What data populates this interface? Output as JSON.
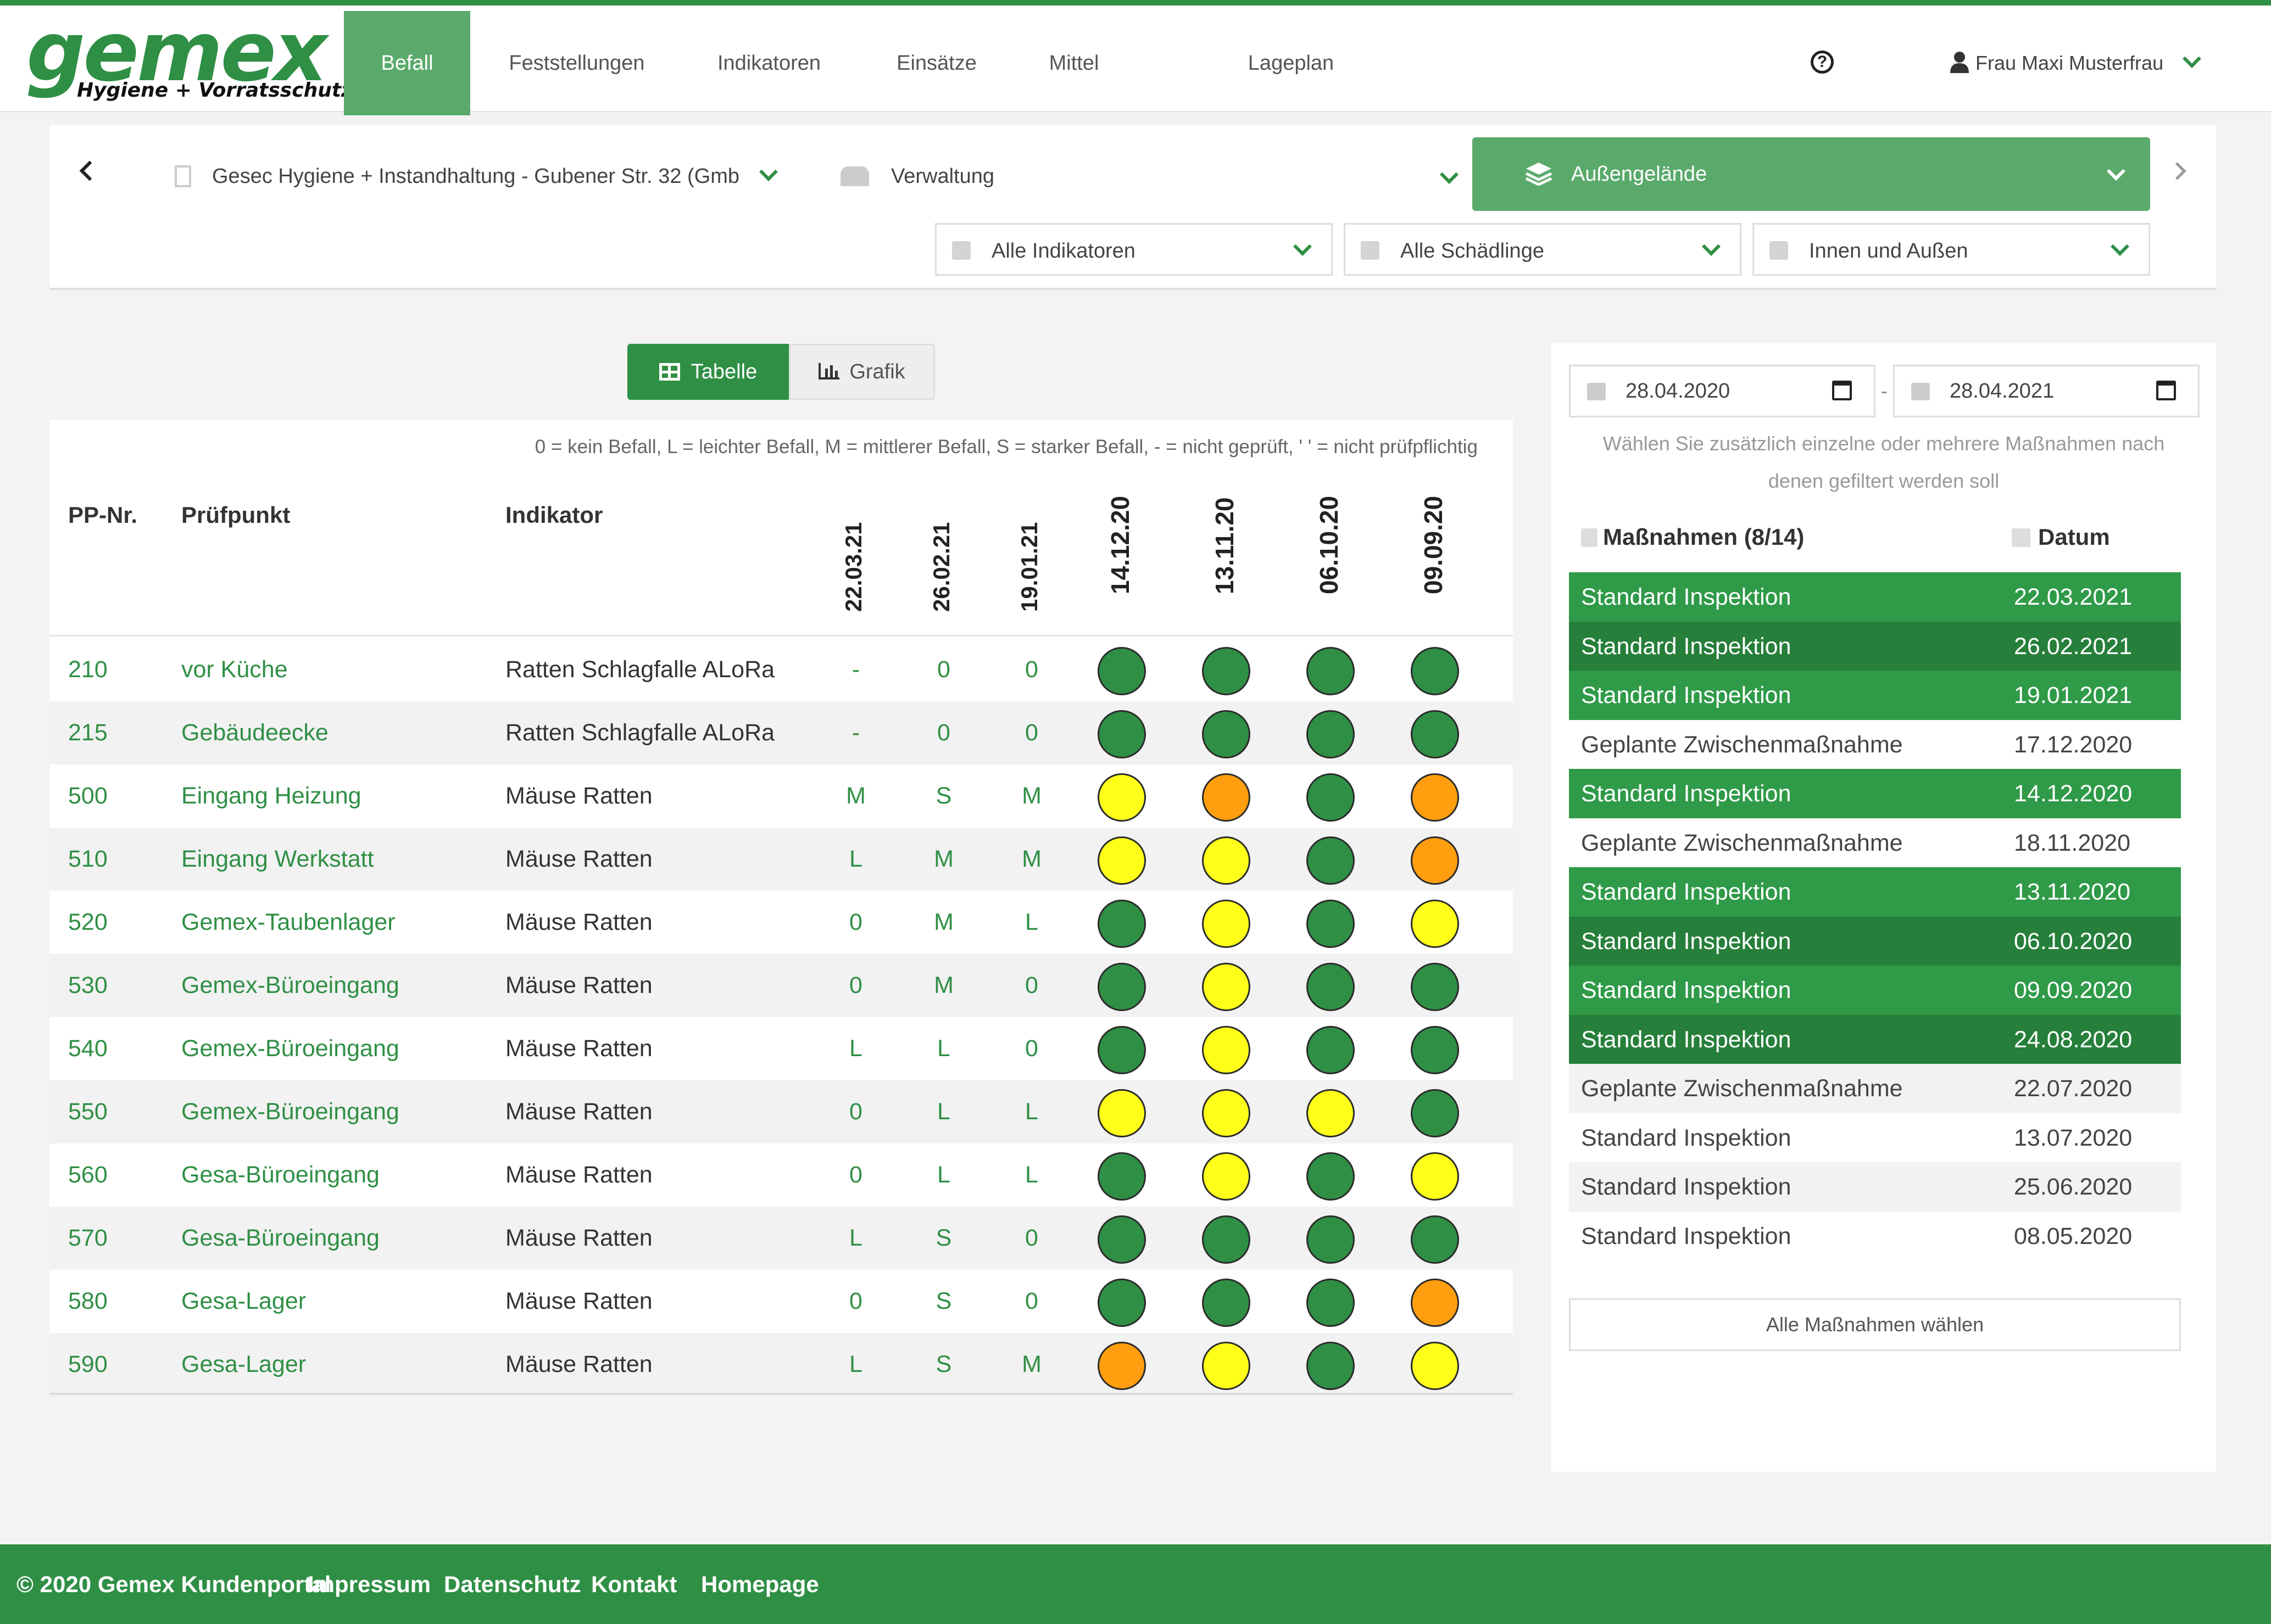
{
  "brand": {
    "name": "gemex",
    "tagline": "Hygiene + Vorratsschutz",
    "color": "#2f8f45"
  },
  "nav": [
    {
      "label": "Befall",
      "active": true
    },
    {
      "label": "Feststellungen"
    },
    {
      "label": "Indikatoren"
    },
    {
      "label": "Einsätze"
    },
    {
      "label": "Mittel"
    },
    {
      "label": "Lageplan"
    }
  ],
  "user": {
    "name": "Frau Maxi Musterfrau"
  },
  "filters": {
    "site": "Gesec Hygiene + Instandhaltung - Gubener Str. 32 (Gmb",
    "building": "Verwaltung",
    "area": "Außengelände",
    "indicators": "Alle Indikatoren",
    "pests": "Alle Schädlinge",
    "location": "Innen und Außen"
  },
  "view": {
    "table_label": "Tabelle",
    "chart_label": "Grafik"
  },
  "table": {
    "legend": "0 = kein Befall, L = leichter Befall, M = mittlerer Befall, S = starker Befall, - = nicht geprüft, ' ' = nicht prüfpflichtig",
    "headers": {
      "pp": "PP-Nr.",
      "point": "Prüfpunkt",
      "indicator": "Indikator"
    },
    "dates_text": [
      "22.03.21",
      "26.02.21",
      "19.01.21"
    ],
    "dates_dots": [
      "14.12.20",
      "13.11.20",
      "06.10.20",
      "09.09.20"
    ],
    "rows": [
      {
        "pp": "210",
        "point": "vor Küche",
        "indicator": "Ratten Schlagfalle ALoRa",
        "v": [
          "-",
          "0",
          "0"
        ],
        "dots": [
          "green",
          "green",
          "green",
          "green"
        ]
      },
      {
        "pp": "215",
        "point": "Gebäudeecke",
        "indicator": "Ratten Schlagfalle ALoRa",
        "v": [
          "-",
          "0",
          "0"
        ],
        "dots": [
          "green",
          "green",
          "green",
          "green"
        ]
      },
      {
        "pp": "500",
        "point": "Eingang Heizung",
        "indicator": "Mäuse Ratten",
        "v": [
          "M",
          "S",
          "M"
        ],
        "dots": [
          "yellow",
          "orange",
          "green",
          "orange"
        ]
      },
      {
        "pp": "510",
        "point": "Eingang Werkstatt",
        "indicator": "Mäuse Ratten",
        "v": [
          "L",
          "M",
          "M"
        ],
        "dots": [
          "yellow",
          "yellow",
          "green",
          "orange"
        ]
      },
      {
        "pp": "520",
        "point": "Gemex-Taubenlager",
        "indicator": "Mäuse Ratten",
        "v": [
          "0",
          "M",
          "L"
        ],
        "dots": [
          "green",
          "yellow",
          "green",
          "yellow"
        ]
      },
      {
        "pp": "530",
        "point": "Gemex-Büroeingang",
        "indicator": "Mäuse Ratten",
        "v": [
          "0",
          "M",
          "0"
        ],
        "dots": [
          "green",
          "yellow",
          "green",
          "green"
        ]
      },
      {
        "pp": "540",
        "point": "Gemex-Büroeingang",
        "indicator": "Mäuse Ratten",
        "v": [
          "L",
          "L",
          "0"
        ],
        "dots": [
          "green",
          "yellow",
          "green",
          "green"
        ]
      },
      {
        "pp": "550",
        "point": "Gemex-Büroeingang",
        "indicator": "Mäuse Ratten",
        "v": [
          "0",
          "L",
          "L"
        ],
        "dots": [
          "yellow",
          "yellow",
          "yellow",
          "green"
        ]
      },
      {
        "pp": "560",
        "point": "Gesa-Büroeingang",
        "indicator": "Mäuse Ratten",
        "v": [
          "0",
          "L",
          "L"
        ],
        "dots": [
          "green",
          "yellow",
          "green",
          "yellow"
        ]
      },
      {
        "pp": "570",
        "point": "Gesa-Büroeingang",
        "indicator": "Mäuse Ratten",
        "v": [
          "L",
          "S",
          "0"
        ],
        "dots": [
          "green",
          "green",
          "green",
          "green"
        ]
      },
      {
        "pp": "580",
        "point": "Gesa-Lager",
        "indicator": "Mäuse Ratten",
        "v": [
          "0",
          "S",
          "0"
        ],
        "dots": [
          "green",
          "green",
          "green",
          "orange"
        ]
      },
      {
        "pp": "590",
        "point": "Gesa-Lager",
        "indicator": "Mäuse Ratten",
        "v": [
          "L",
          "S",
          "M"
        ],
        "dots": [
          "orange",
          "yellow",
          "green",
          "yellow"
        ]
      }
    ]
  },
  "dot_colors": {
    "green": "#2f8f45",
    "yellow": "#ffff1a",
    "orange": "#ff9e0f"
  },
  "side": {
    "date_from": "28.04.2020",
    "date_to": "28.04.2021",
    "date_sep": "-",
    "hint": "Wählen Sie zusätzlich einzelne oder mehrere Maßnahmen nach denen gefiltert werden soll",
    "col_measure": "Maßnahmen (8/14)",
    "col_date": "Datum",
    "measures": [
      {
        "name": "Standard Inspektion",
        "date": "22.03.2021",
        "selected": true
      },
      {
        "name": "Standard Inspektion",
        "date": "26.02.2021",
        "selected": true
      },
      {
        "name": "Standard Inspektion",
        "date": "19.01.2021",
        "selected": true
      },
      {
        "name": "Geplante Zwischenmaßnahme",
        "date": "17.12.2020",
        "selected": false
      },
      {
        "name": "Standard Inspektion",
        "date": "14.12.2020",
        "selected": true
      },
      {
        "name": "Geplante Zwischenmaßnahme",
        "date": "18.11.2020",
        "selected": false
      },
      {
        "name": "Standard Inspektion",
        "date": "13.11.2020",
        "selected": true
      },
      {
        "name": "Standard Inspektion",
        "date": "06.10.2020",
        "selected": true
      },
      {
        "name": "Standard Inspektion",
        "date": "09.09.2020",
        "selected": true
      },
      {
        "name": "Standard Inspektion",
        "date": "24.08.2020",
        "selected": true
      },
      {
        "name": "Geplante Zwischenmaßnahme",
        "date": "22.07.2020",
        "selected": false
      },
      {
        "name": "Standard Inspektion",
        "date": "13.07.2020",
        "selected": false
      },
      {
        "name": "Standard Inspektion",
        "date": "25.06.2020",
        "selected": false
      },
      {
        "name": "Standard Inspektion",
        "date": "08.05.2020",
        "selected": false
      }
    ],
    "select_all": "Alle Maßnahmen wählen"
  },
  "footer": {
    "copyright": "© 2020 Gemex Kundenportal",
    "links": [
      "Impressum",
      "Datenschutz",
      "Kontakt",
      "Homepage"
    ]
  }
}
